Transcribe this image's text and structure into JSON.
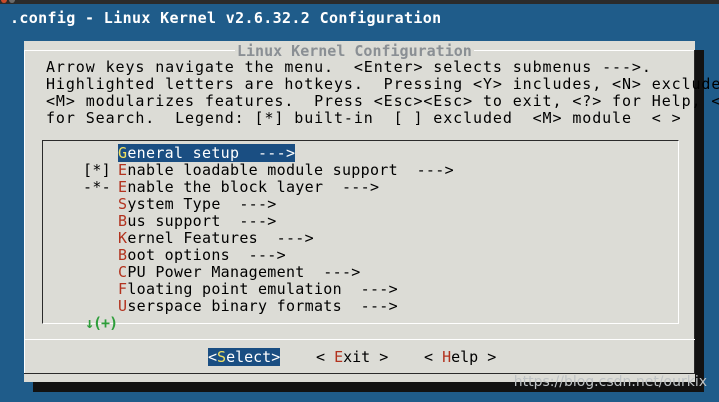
{
  "window": {
    "title": ".config - Linux Kernel v2.6.32.2 Configuration"
  },
  "dialog": {
    "title": "Linux Kernel Configuration",
    "help_lines": [
      "Arrow keys navigate the menu.  <Enter> selects submenus --->.",
      "Highlighted letters are hotkeys.  Pressing <Y> includes, <N> excludes,",
      "<M> modularizes features.  Press <Esc><Esc> to exit, <?> for Help, </>",
      "for Search.  Legend: [*] built-in  [ ] excluded  <M> module  < >"
    ]
  },
  "menu": {
    "items": [
      {
        "prefix": "",
        "hotkey": "G",
        "rest": "eneral setup  --->",
        "selected": true
      },
      {
        "prefix": "[*]",
        "hotkey": "E",
        "rest": "nable loadable module support  --->",
        "selected": false
      },
      {
        "prefix": "-*-",
        "hotkey": "E",
        "rest": "nable the block layer  --->",
        "selected": false
      },
      {
        "prefix": "",
        "hotkey": "S",
        "rest": "ystem Type  --->",
        "selected": false
      },
      {
        "prefix": "",
        "hotkey": "B",
        "rest": "us support  --->",
        "selected": false
      },
      {
        "prefix": "",
        "hotkey": "K",
        "rest": "ernel Features  --->",
        "selected": false
      },
      {
        "prefix": "",
        "hotkey": "B",
        "rest": "oot options  --->",
        "selected": false
      },
      {
        "prefix": "",
        "hotkey": "C",
        "rest": "PU Power Management  --->",
        "selected": false
      },
      {
        "prefix": "",
        "hotkey": "F",
        "rest": "loating point emulation  --->",
        "selected": false
      },
      {
        "prefix": "",
        "hotkey": "U",
        "rest": "serspace binary formats  --->",
        "selected": false
      }
    ],
    "more_indicator": "↓(+)"
  },
  "buttons": {
    "select": {
      "open": "<",
      "hotkey": "S",
      "rest": "elect",
      "close": ">"
    },
    "exit": {
      "open": "< ",
      "hotkey": "E",
      "rest": "xit",
      "close": " >"
    },
    "help": {
      "open": "< ",
      "hotkey": "H",
      "rest": "elp",
      "close": " >"
    }
  },
  "watermark": "https://blog.csdn.net/ourkix",
  "colors": {
    "background": "#1f5c8a",
    "dialog": "#dcdcd6",
    "selection": "#1a4e82",
    "hotkey": "#b2321e",
    "more_indicator": "#2e9e3b"
  }
}
